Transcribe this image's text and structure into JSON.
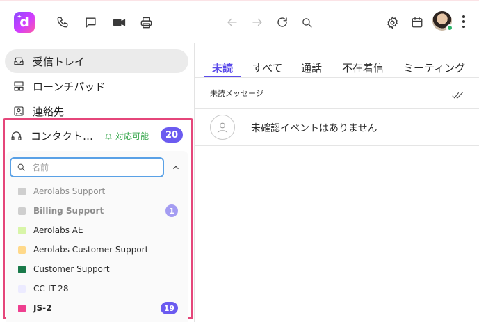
{
  "app": {
    "logo_letter": "d"
  },
  "topbar": {
    "icons": [
      "phone-icon",
      "message-icon",
      "video-icon",
      "print-icon",
      "back-arrow-icon",
      "forward-arrow-icon",
      "refresh-icon",
      "search-icon",
      "gear-icon",
      "calendar-icon",
      "avatar",
      "more-vertical-icon"
    ]
  },
  "sidebar": {
    "items": [
      {
        "label": "受信トレイ",
        "icon": "inbox-icon",
        "active": true
      },
      {
        "label": "ローンチパッド",
        "icon": "launchpad-icon",
        "active": false
      },
      {
        "label": "連絡先",
        "icon": "contacts-icon",
        "active": false
      }
    ],
    "contact_center": {
      "title": "コンタクト…",
      "status": "対応可能",
      "count": "20",
      "search_placeholder": "名前",
      "teams": [
        {
          "name": "Aerolabs Support",
          "color": "#cfcfcf",
          "muted": true,
          "bold": false,
          "badge": ""
        },
        {
          "name": "Billing Support",
          "color": "#cfcfcf",
          "muted": true,
          "bold": true,
          "badge": "1",
          "badge_color": "#a49cf2"
        },
        {
          "name": "Aerolabs AE",
          "color": "#d8f5a8",
          "muted": false,
          "bold": false,
          "badge": ""
        },
        {
          "name": "Aerolabs Customer Support",
          "color": "#ffd98a",
          "muted": false,
          "bold": false,
          "badge": ""
        },
        {
          "name": "Customer Support",
          "color": "#1a7a4a",
          "muted": false,
          "bold": false,
          "badge": ""
        },
        {
          "name": "CC-IT-28",
          "color": "#ecebff",
          "muted": false,
          "bold": false,
          "badge": ""
        },
        {
          "name": "JS-2",
          "color": "#ee3f8f",
          "muted": false,
          "bold": true,
          "badge": "19",
          "badge_color": "#6b5bf0"
        }
      ]
    }
  },
  "main": {
    "tabs": [
      {
        "label": "未読",
        "active": true
      },
      {
        "label": "すべて",
        "active": false
      },
      {
        "label": "通話",
        "active": false
      },
      {
        "label": "不在着信",
        "active": false
      },
      {
        "label": "ミーティング",
        "active": false
      }
    ],
    "section_title": "未読メッセージ",
    "empty_message": "未確認イベントはありません"
  },
  "colors": {
    "accent": "#5b4bea",
    "highlight": "#e5467a",
    "online": "#2fb36b"
  }
}
